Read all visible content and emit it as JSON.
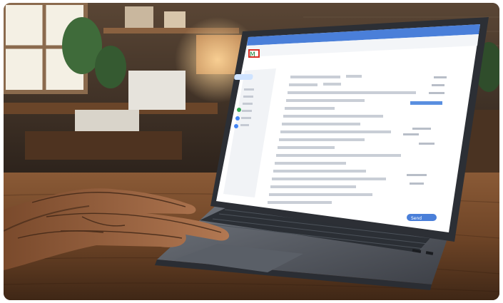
{
  "scene": {
    "description_type": "illustration",
    "palette": {
      "wall_dark": "#2a211b",
      "window_glow": "#f3efe3",
      "wood_light": "#b07a4a",
      "wood_dark": "#6b4426",
      "laptop_body": "#3b3f46",
      "screen_bg": "#ffffff",
      "mail_accent": "#3b82f6",
      "skin": "#a56b45"
    }
  },
  "screen": {
    "app": "email-client",
    "logo_letter": "M",
    "send_label": "Send"
  }
}
